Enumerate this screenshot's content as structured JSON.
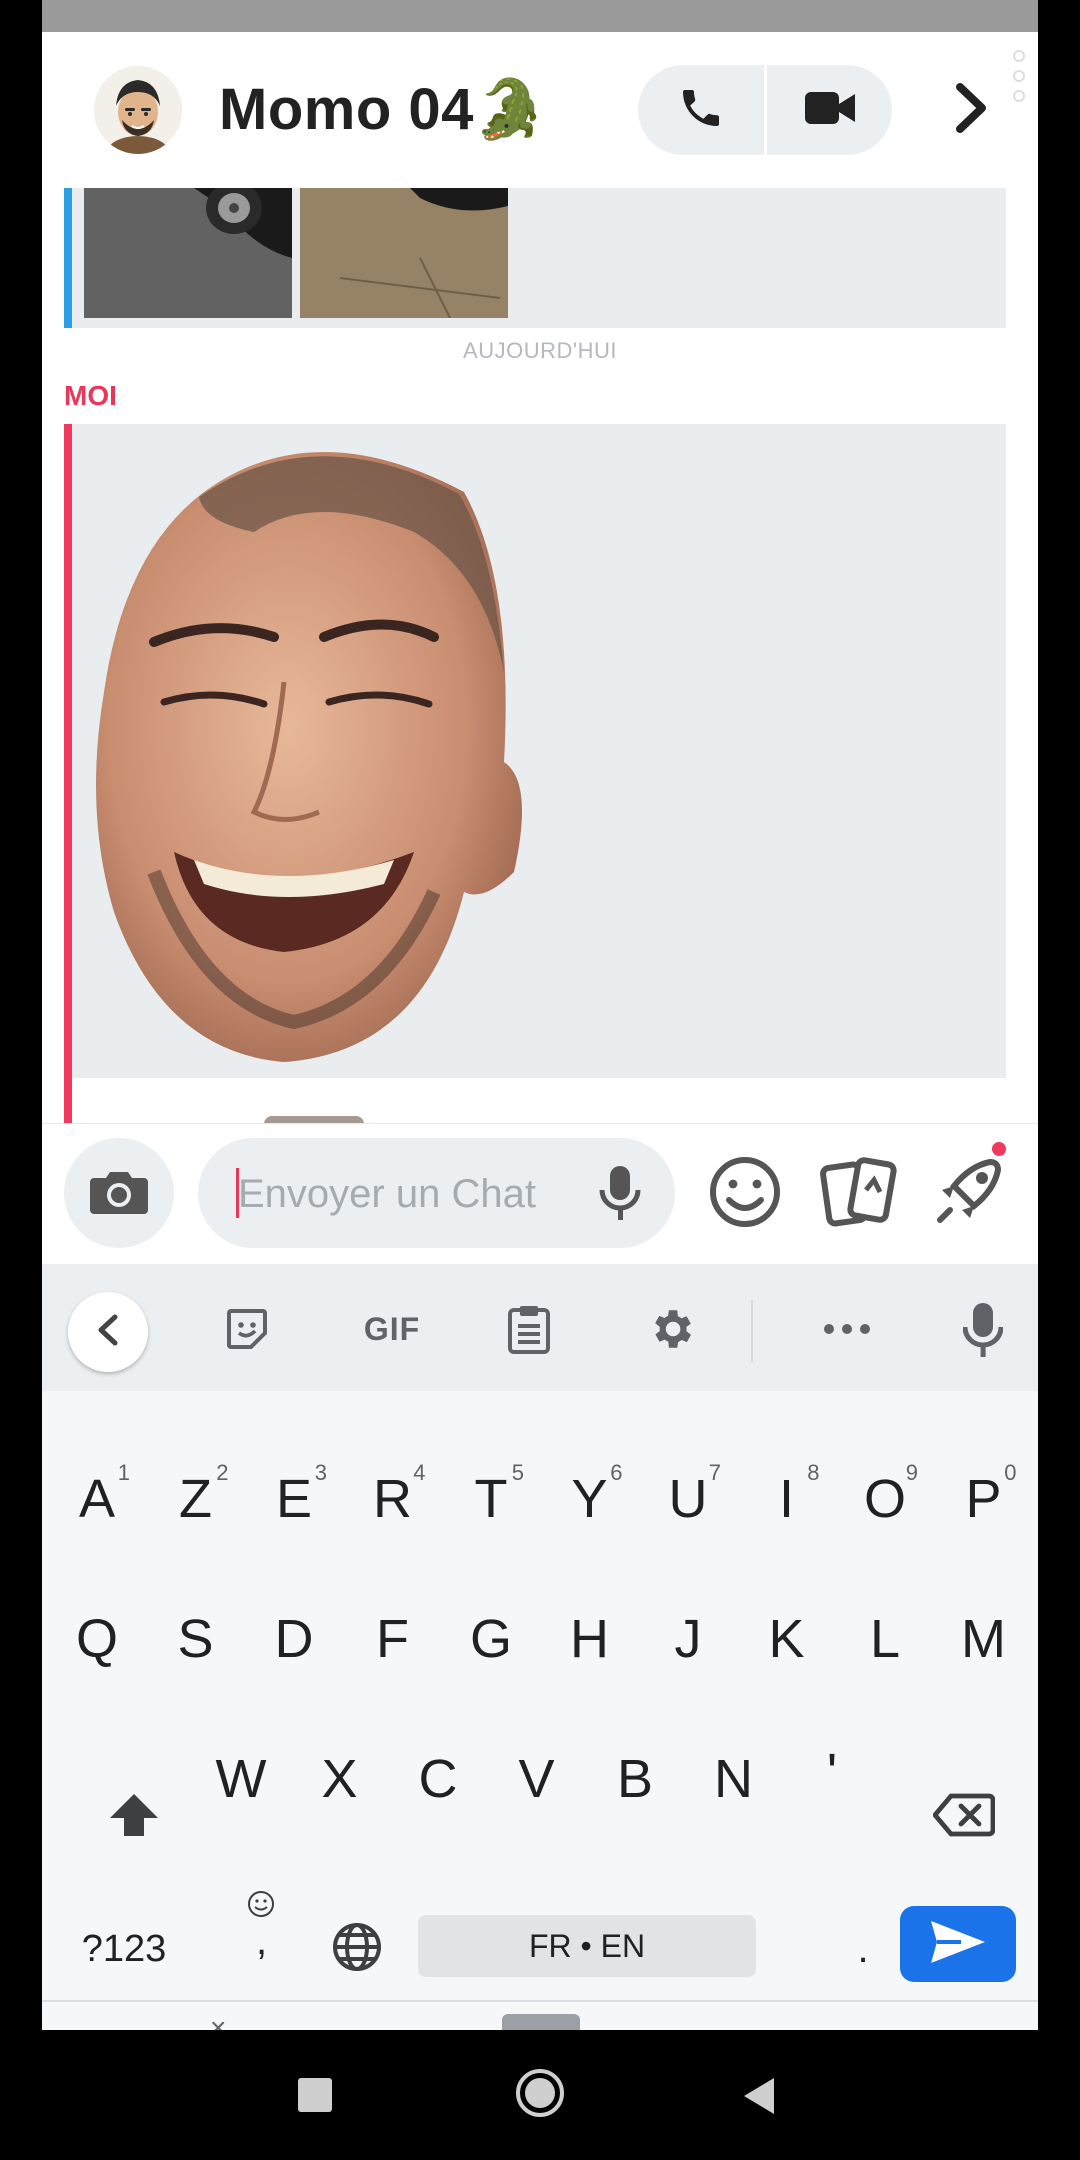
{
  "header": {
    "title": "Momo 04🐊"
  },
  "messages": {
    "day_separator": "AUJOURD'HUI",
    "sender": "MOI"
  },
  "input": {
    "placeholder": "Envoyer un Chat"
  },
  "keyboard": {
    "toolbar": {
      "gif_label": "GIF"
    },
    "row1": [
      {
        "key": "A",
        "hint": "1"
      },
      {
        "key": "Z",
        "hint": "2"
      },
      {
        "key": "E",
        "hint": "3"
      },
      {
        "key": "R",
        "hint": "4"
      },
      {
        "key": "T",
        "hint": "5"
      },
      {
        "key": "Y",
        "hint": "6"
      },
      {
        "key": "U",
        "hint": "7"
      },
      {
        "key": "I",
        "hint": "8"
      },
      {
        "key": "O",
        "hint": "9"
      },
      {
        "key": "P",
        "hint": "0"
      }
    ],
    "row2": [
      "Q",
      "S",
      "D",
      "F",
      "G",
      "H",
      "J",
      "K",
      "L",
      "M"
    ],
    "row3": [
      "W",
      "X",
      "C",
      "V",
      "B",
      "N",
      "'"
    ],
    "symbols_label": "?123",
    "comma_label": ",",
    "space_label": "FR • EN",
    "period_label": ".",
    "bottom_close": "×"
  },
  "icons": {
    "call": "phone-icon",
    "video": "video-camera-icon",
    "forward": "chevron-right-icon",
    "camera": "camera-icon",
    "mic": "microphone-icon",
    "emoji": "smiley-icon",
    "cards": "cards-icon",
    "rocket": "rocket-icon",
    "sticker": "sticker-icon",
    "clipboard": "clipboard-icon",
    "settings": "gear-icon",
    "more": "more-dots-icon",
    "globe": "globe-icon",
    "backspace": "backspace-icon",
    "shift": "shift-arrow-icon",
    "send": "send-arrow-icon"
  },
  "colors": {
    "accent_red": "#e8385a",
    "accent_blue": "#2c9ee6",
    "enter_blue": "#1a73e8",
    "bubble_grey": "#eaedf0"
  }
}
